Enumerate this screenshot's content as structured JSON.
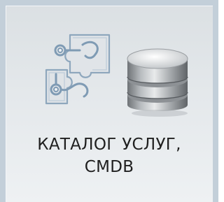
{
  "tile": {
    "title_line1": "КАТАЛОГ УСЛУГ,",
    "title_line2": "CMDB",
    "icons": [
      "puzzle-services-icon",
      "database-icon"
    ]
  }
}
